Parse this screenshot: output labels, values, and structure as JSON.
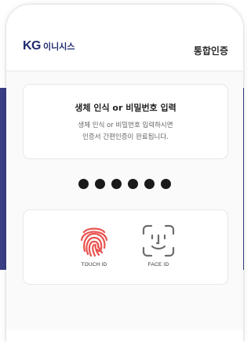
{
  "header": {
    "logo_mark": "KG",
    "logo_name": "이니시스",
    "action_label": "통합인증"
  },
  "info": {
    "title": "생체 인식 or 비밀번호 입력",
    "desc_line1": "생체 인식 or 비밀번호 입력하시면",
    "desc_line2": "인증서 간편인증이 완료됩니다."
  },
  "pin": {
    "entered_count": 6
  },
  "auth_options": [
    {
      "label": "TOUCH ID",
      "icon": "fingerprint-icon"
    },
    {
      "label": "FACE ID",
      "icon": "face-id-icon"
    }
  ],
  "colors": {
    "brand": "#1f2a6e",
    "side_band": "#3a3f86",
    "fingerprint": "#e8534f",
    "face_id": "#6d6d6d",
    "pin_dot": "#1a1a1a"
  }
}
